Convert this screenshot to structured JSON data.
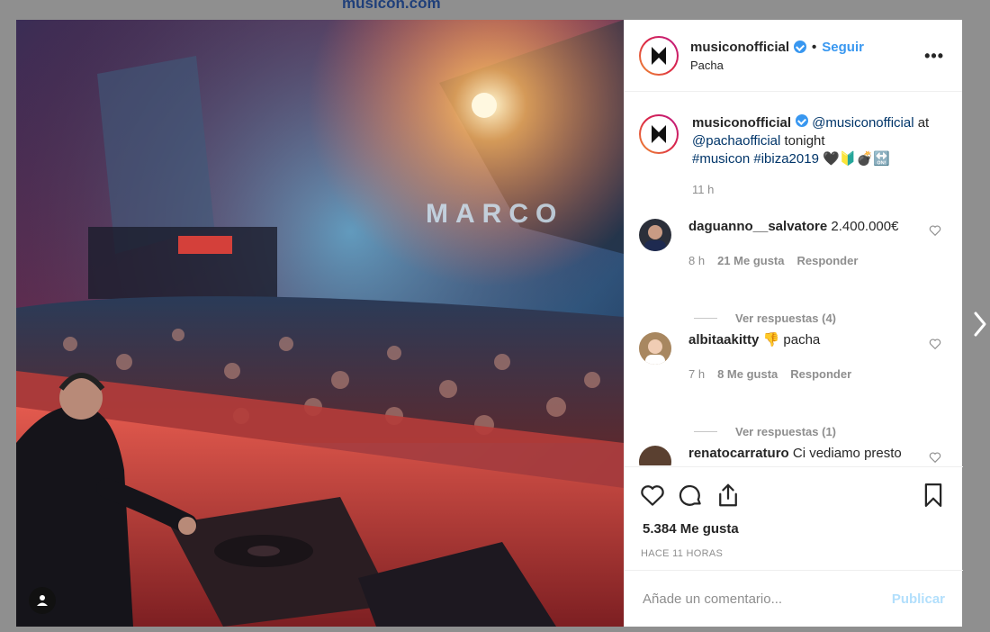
{
  "site": {
    "title": "musicon.com"
  },
  "post": {
    "username": "musiconofficial",
    "follow_label": "Seguir",
    "separator": "•",
    "location": "Pacha",
    "more_label": "•••",
    "caption": {
      "username": "musiconofficial",
      "mention1": "@musiconofficial",
      "text1": " at",
      "mention2": "@pachaofficial",
      "text2": " tonight",
      "hashtags": "#musicon #ibiza2019",
      "emojis": "🖤🔰💣🔛",
      "time": "11 h"
    },
    "comments": [
      {
        "username": "daguanno__salvatore",
        "text": " 2.400.000€",
        "time": "8 h",
        "likes": "21 Me gusta",
        "reply": "Responder",
        "view_replies": "Ver respuestas (4)"
      },
      {
        "username": "albitaakitty",
        "text": " 👎 pacha",
        "time": "7 h",
        "likes": "8 Me gusta",
        "reply": "Responder",
        "view_replies": "Ver respuestas (1)"
      },
      {
        "username": "renatocarraturo",
        "text": " Ci vediamo presto"
      }
    ],
    "likes_count": "5.384 Me gusta",
    "posted_ago": "HACE 11 HORAS",
    "comment_placeholder": "Añade un comentario...",
    "publish_label": "Publicar",
    "photo_sign_text": "MARCO"
  },
  "colors": {
    "accent": "#3897f0",
    "publish_disabled": "#b2dffc",
    "muted": "#8e8e8e"
  }
}
